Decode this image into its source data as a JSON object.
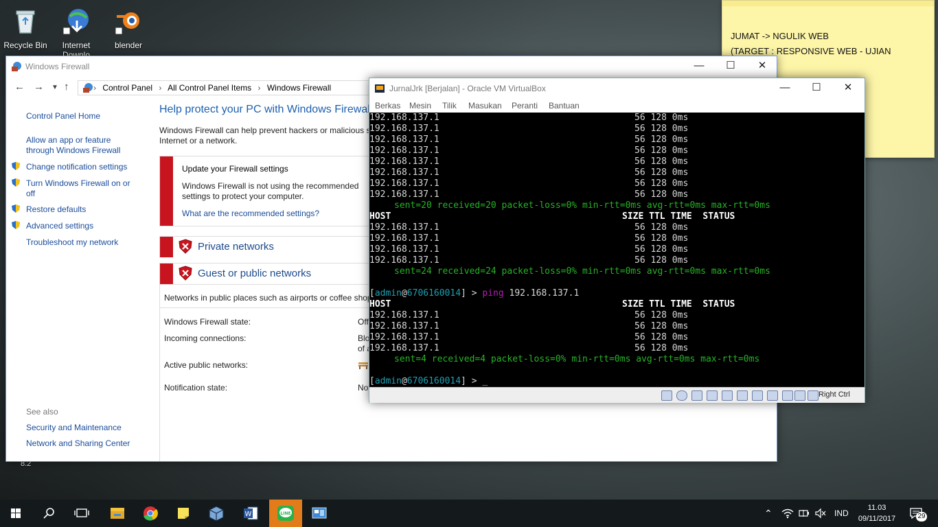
{
  "desktop": {
    "icons": [
      {
        "label": "Recycle Bin"
      },
      {
        "label": "Internet Downlo"
      },
      {
        "label": "blender"
      }
    ],
    "edge_text": "8.2"
  },
  "sticky_note": {
    "lines": [
      "JUMAT -> NGULIK WEB",
      "(TARGET : RESPONSIVE WEB - UJIAN"
    ]
  },
  "firewall": {
    "title": "Windows Firewall",
    "breadcrumb": [
      "Control Panel",
      "All Control Panel Items",
      "Windows Firewall"
    ],
    "sidebar": {
      "home": "Control Panel Home",
      "allow_app": [
        "Allow an app or feature",
        "through Windows Firewall"
      ],
      "change_notifications": "Change notification settings",
      "turn_on_off": [
        "Turn Windows Firewall on or",
        "off"
      ],
      "restore_defaults": "Restore defaults",
      "advanced": "Advanced settings",
      "troubleshoot": "Troubleshoot my network",
      "see_also": "See also",
      "security_maintenance": "Security and Maintenance",
      "network_sharing": "Network and Sharing Center"
    },
    "main": {
      "heading": "Help protect your PC with Windows Firewall",
      "desc": [
        "Windows Firewall can help prevent hackers or malicious so",
        "Internet or a network."
      ],
      "alert_title": "Update your Firewall settings",
      "alert_body": [
        "Windows Firewall is not using the recommended",
        "settings to protect your computer."
      ],
      "alert_link": "What are the recommended settings?",
      "private_networks": "Private networks",
      "guest_public_networks": "Guest or public networks",
      "public_desc": "Networks in public places such as airports or coffee shop",
      "state_label": "Windows Firewall state:",
      "state_value": "Off",
      "incoming_label": "Incoming connections:",
      "incoming_value": [
        "Blo",
        "of a"
      ],
      "active_label": "Active public networks:",
      "notification_label": "Notification state:",
      "notification_value": "Not"
    }
  },
  "vbox": {
    "title": "JurnalJrk [Berjalan] - Oracle VM VirtualBox",
    "menu": [
      "Berkas",
      "Mesin",
      "Tilik",
      "Masukan",
      "Peranti",
      "Bantuan"
    ],
    "host_key": "Right Ctrl",
    "terminal": {
      "ip": "192.168.137.1",
      "row_stats": "56 128 0ms",
      "header_host": "HOST",
      "header_cols": "SIZE TTL TIME  STATUS",
      "summary1": {
        "sent": "sent=20",
        "received": "received=20",
        "loss": "packet-loss=0%",
        "min": "min-rtt=0ms",
        "avg": "avg-rtt=0ms",
        "max": "max-rtt=0ms"
      },
      "summary2": {
        "sent": "sent=24",
        "received": "received=24",
        "loss": "packet-loss=0%",
        "min": "min-rtt=0ms",
        "avg": "avg-rtt=0ms",
        "max": "max-rtt=0ms"
      },
      "summary3": {
        "sent": "sent=4",
        "received": "received=4",
        "loss": "packet-loss=0%",
        "min": "min-rtt=0ms",
        "avg": "avg-rtt=0ms",
        "max": "max-rtt=0ms"
      },
      "prompt_user": "admin",
      "prompt_host": "6706160014",
      "command": "ping",
      "command_arg": "192.168.137.1"
    }
  },
  "taskbar": {
    "language": "IND",
    "time": "11.03",
    "date": "09/11/2017",
    "notification_count": "29"
  },
  "colors": {
    "alert_red": "#c8141e",
    "link_blue": "#1a4c9a",
    "term_green": "#26b426",
    "term_cyan": "#1ea0b4",
    "term_magenta": "#b41eb4",
    "line_app": "#e27b1a"
  }
}
